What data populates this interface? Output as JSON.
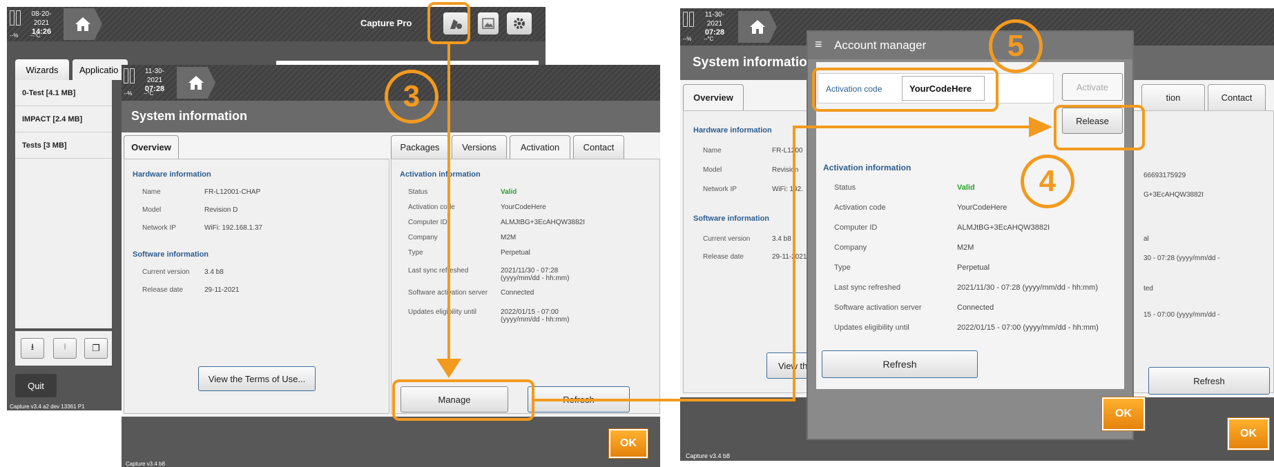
{
  "left_back": {
    "date": "08-20-2021",
    "time": "14:26",
    "humidity": "--%",
    "temp": "--°C",
    "app_title": "Capture Pro",
    "tabs": [
      "Wizards",
      "Applicatio"
    ],
    "list": [
      "0-Test [4.1  MB]",
      "IMPACT [2.4  MB]",
      "Tests [3  MB]"
    ],
    "quit": "Quit",
    "version": "Capture v3.4 a2 dev 13361 P1"
  },
  "left_front": {
    "date": "11-30-2021",
    "time": "07:28",
    "humidity": "--%",
    "temp": "--°C",
    "title": "System information",
    "tab_overview": "Overview",
    "tabs_right": [
      "Packages",
      "Versions",
      "Activation",
      "Contact"
    ],
    "hardware_title": "Hardware information",
    "hardware": [
      {
        "label": "Name",
        "value": "FR-L12001-CHAP"
      },
      {
        "label": "Model",
        "value": "Revision D"
      },
      {
        "label": "Network IP",
        "value": "WiFi: 192.168.1.37"
      }
    ],
    "software_title": "Software information",
    "software": [
      {
        "label": "Current version",
        "value": "3.4 b8"
      },
      {
        "label": "Release date",
        "value": "29-11-2021"
      }
    ],
    "terms_button": "View the Terms of Use...",
    "activation_title": "Activation information",
    "activation": [
      {
        "label": "Status",
        "value": "Valid"
      },
      {
        "label": "Activation code",
        "value": "YourCodeHere"
      },
      {
        "label": "Computer ID",
        "value": "ALMJtBG+3EcAHQW3882I"
      },
      {
        "label": "Company",
        "value": "M2M"
      },
      {
        "label": "Type",
        "value": "Perpetual"
      },
      {
        "label": "Last sync refreshed",
        "value": "2021/11/30 - 07:28 (yyyy/mm/dd - hh:mm)"
      },
      {
        "label": "Software activation server",
        "value": "Connected"
      },
      {
        "label": "Updates eligibility until",
        "value": "2022/01/15 - 07:00 (yyyy/mm/dd - hh:mm)"
      }
    ],
    "manage_button": "Manage",
    "refresh_button": "Refresh",
    "ok": "OK",
    "version": "Capture v3.4 b8"
  },
  "right": {
    "date": "11-30-2021",
    "time": "07:28",
    "humidity": "--%",
    "temp": "--°C",
    "bg_title": "System informatio",
    "bg_tab_overview": "Overview",
    "bg_tabs": [
      "tion",
      "Contact"
    ],
    "bg_hardware_title": "Hardware information",
    "bg_hardware": [
      {
        "label": "Name",
        "value": "FR-L1200"
      },
      {
        "label": "Model",
        "value": "Revision"
      },
      {
        "label": "Network IP",
        "value": "WiFi: 192."
      }
    ],
    "bg_software_title": "Software information",
    "bg_software": [
      {
        "label": "Current version",
        "value": "3.4 b8"
      },
      {
        "label": "Release date",
        "value": "29-11-2021"
      }
    ],
    "bg_right_values": [
      "66693175929",
      "G+3EcAHQW3882I",
      "al",
      "30 - 07:28 (yyyy/mm/dd -",
      "ted",
      "15 - 07:00 (yyyy/mm/dd -"
    ],
    "bg_view": "View th",
    "bg_refresh": "Refresh",
    "bg_ok": "OK",
    "version": "Capture v3.4 b8"
  },
  "dialog": {
    "title": "Account manager",
    "code_label": "Activation code",
    "code_value": "YourCodeHere",
    "activate": "Activate",
    "release": "Release",
    "info_title": "Activation information",
    "rows": [
      {
        "label": "Status",
        "value": "Valid"
      },
      {
        "label": "Activation code",
        "value": "YourCodeHere"
      },
      {
        "label": "Computer ID",
        "value": "ALMJtBG+3EcAHQW3882I"
      },
      {
        "label": "Company",
        "value": "M2M"
      },
      {
        "label": "Type",
        "value": "Perpetual"
      },
      {
        "label": "Last sync refreshed",
        "value": "2021/11/30 - 07:28 (yyyy/mm/dd - hh:mm)"
      },
      {
        "label": "Software activation server",
        "value": "Connected"
      },
      {
        "label": "Updates eligibility until",
        "value": "2022/01/15 - 07:00 (yyyy/mm/dd - hh:mm)"
      }
    ],
    "refresh": "Refresh",
    "ok": "OK"
  },
  "callouts": [
    "3",
    "4",
    "5"
  ],
  "colors": {
    "accent": "#f29a1f",
    "valid": "#2aa02a",
    "section": "#2d5d8f"
  }
}
